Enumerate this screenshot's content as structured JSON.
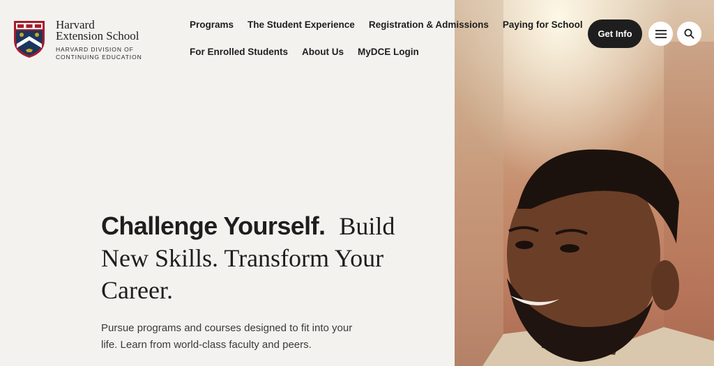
{
  "brand": {
    "name_line1": "Harvard",
    "name_line2": "Extension School",
    "division_line1": "HARVARD DIVISION OF",
    "division_line2": "CONTINUING EDUCATION",
    "shield_icon": "harvard-shield-icon",
    "colors": {
      "crimson": "#a51c30",
      "navy": "#1b365d",
      "gold": "#c9a227"
    }
  },
  "nav": {
    "row1": [
      "Programs",
      "The Student Experience",
      "Registration & Admissions",
      "Paying for School"
    ],
    "row2": [
      "For Enrolled Students",
      "About Us",
      "MyDCE Login"
    ]
  },
  "header_actions": {
    "get_info_label": "Get Info",
    "menu_icon": "hamburger-menu-icon",
    "search_icon": "search-icon"
  },
  "hero": {
    "headline_bold": "Challenge Yourself.",
    "headline_light": "Build New Skills. Transform Your Career.",
    "subtext": "Pursue programs and courses designed to fit into your life. Learn from world-class faculty and peers."
  },
  "colors": {
    "page_bg": "#f3f2ef",
    "text": "#1e1e1e",
    "button_dark": "#1e1e1e"
  }
}
